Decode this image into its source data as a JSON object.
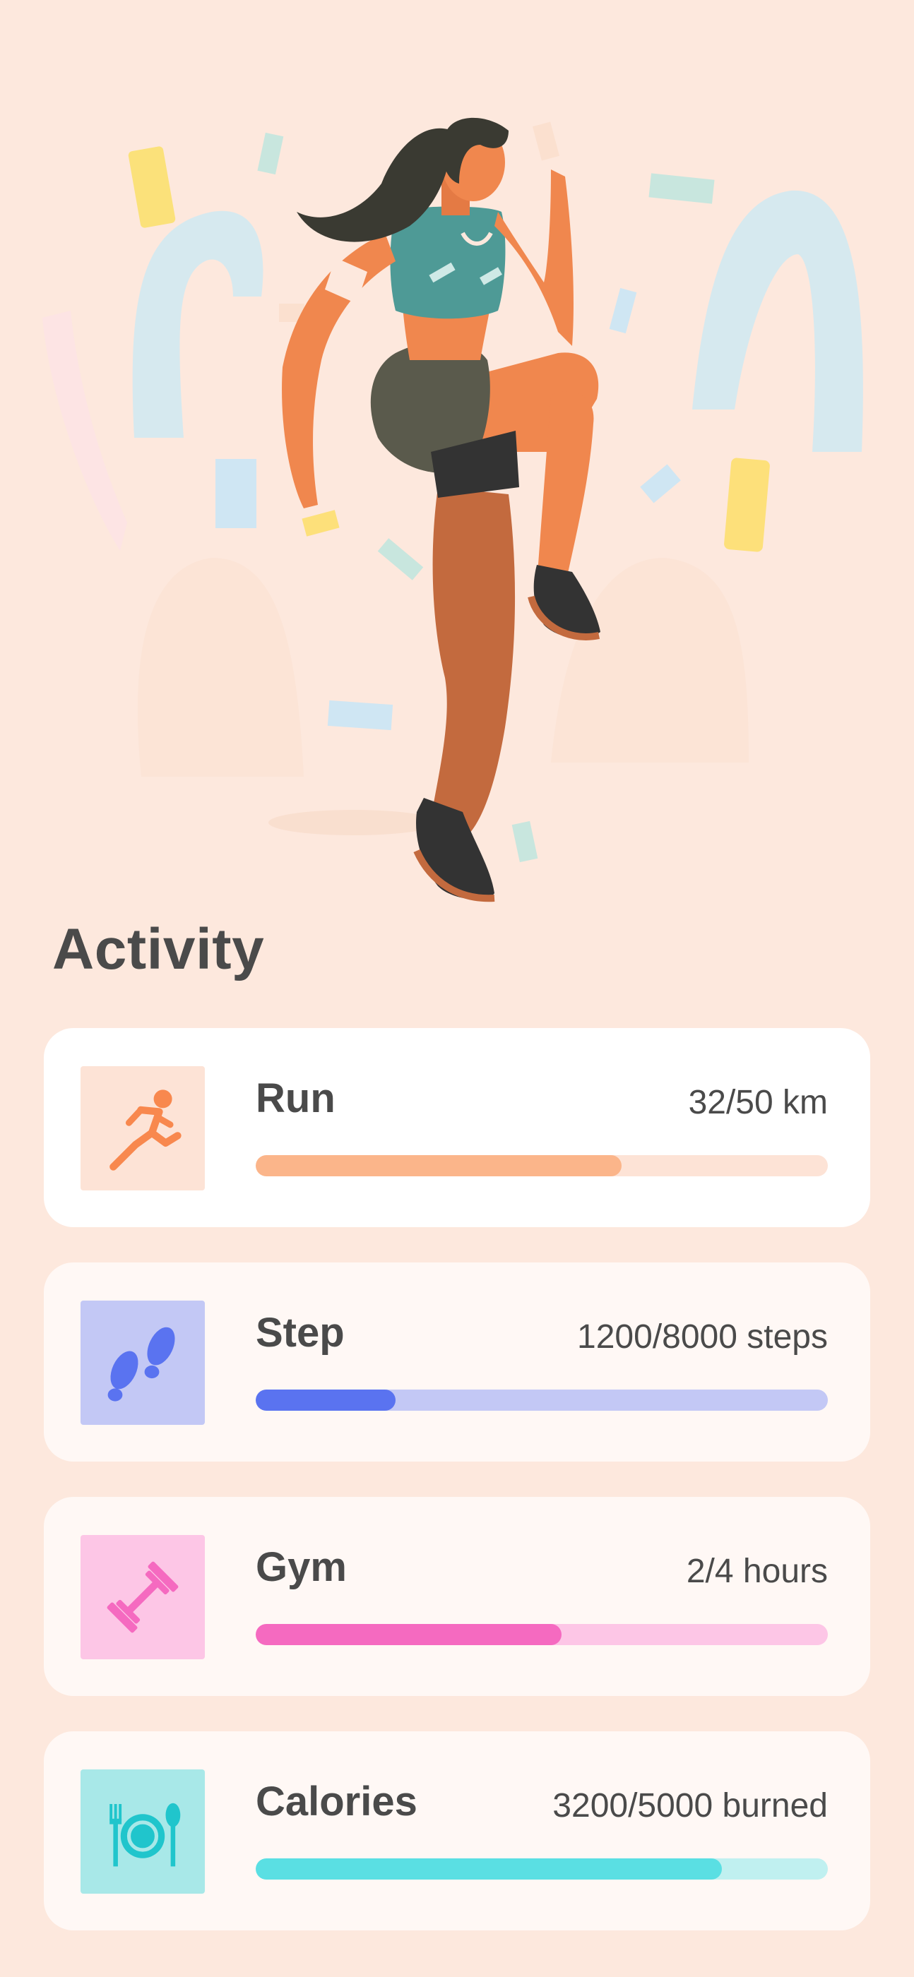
{
  "page": {
    "title": "Activity"
  },
  "activities": [
    {
      "name": "Run",
      "value": "32/50 km",
      "progress": 0.64,
      "icon": "running-person-icon",
      "colors": {
        "tile": "#fde3d6",
        "icon": "#f8884e",
        "fill": "#fbb58a",
        "track": "#fde3d6"
      }
    },
    {
      "name": "Step",
      "value": "1200/8000 steps",
      "progress": 0.245,
      "icon": "footprints-icon",
      "colors": {
        "tile": "#c3c8f5",
        "icon": "#5a73f0",
        "fill": "#5a73f0",
        "track": "#c3c8f5"
      }
    },
    {
      "name": "Gym",
      "value": "2/4 hours",
      "progress": 0.535,
      "icon": "dumbbell-icon",
      "colors": {
        "tile": "#fdc6e6",
        "icon": "#f56ac0",
        "fill": "#f56ac0",
        "track": "#fdc6e6"
      }
    },
    {
      "name": "Calories",
      "value": "3200/5000 burned",
      "progress": 0.815,
      "icon": "plate-fork-spoon-icon",
      "colors": {
        "tile": "#a8e8e8",
        "icon": "#20c5cc",
        "fill": "#5adfe3",
        "track": "#c0f0f0"
      }
    }
  ]
}
